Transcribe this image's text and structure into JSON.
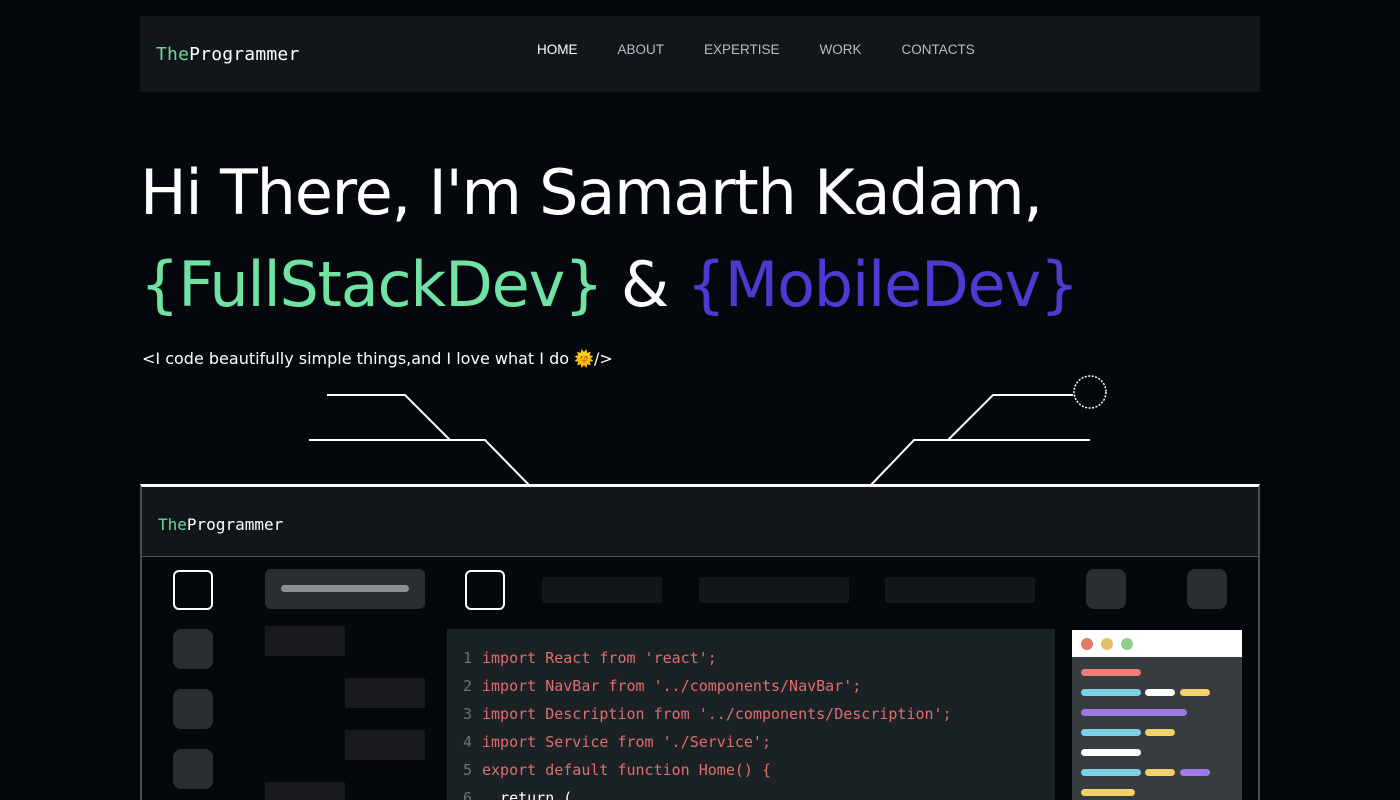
{
  "navbar": {
    "logo_prefix": "The",
    "logo_suffix": "Programmer",
    "links": [
      "HOME",
      "ABOUT",
      "EXPERTISE",
      "WORK",
      "CONTACTS"
    ]
  },
  "hero": {
    "line1": "Hi There, I'm Samarth Kadam,",
    "role1": "{FullStackDev}",
    "amp": "&",
    "role2": "{MobileDev}",
    "tagline": "<I code beautifully simple things,and I love what I do 🌞/>"
  },
  "frame": {
    "logo_prefix": "The",
    "logo_suffix": "Programmer"
  },
  "editor": {
    "lines": [
      {
        "num": "1",
        "code": "import React from 'react';"
      },
      {
        "num": "2",
        "code": "import NavBar from '../components/NavBar';"
      },
      {
        "num": "3",
        "code": "import Description from '../components/Description';"
      },
      {
        "num": "4",
        "code": "import Service from './Service';"
      },
      {
        "num": "5",
        "code": "export default function Home() {"
      },
      {
        "num": "6",
        "code": "  return ("
      }
    ]
  },
  "colors": {
    "green": "#6fe3a4",
    "purple": "#4b3bd0",
    "code_red": "#e06c6c",
    "background": "#04080c"
  }
}
